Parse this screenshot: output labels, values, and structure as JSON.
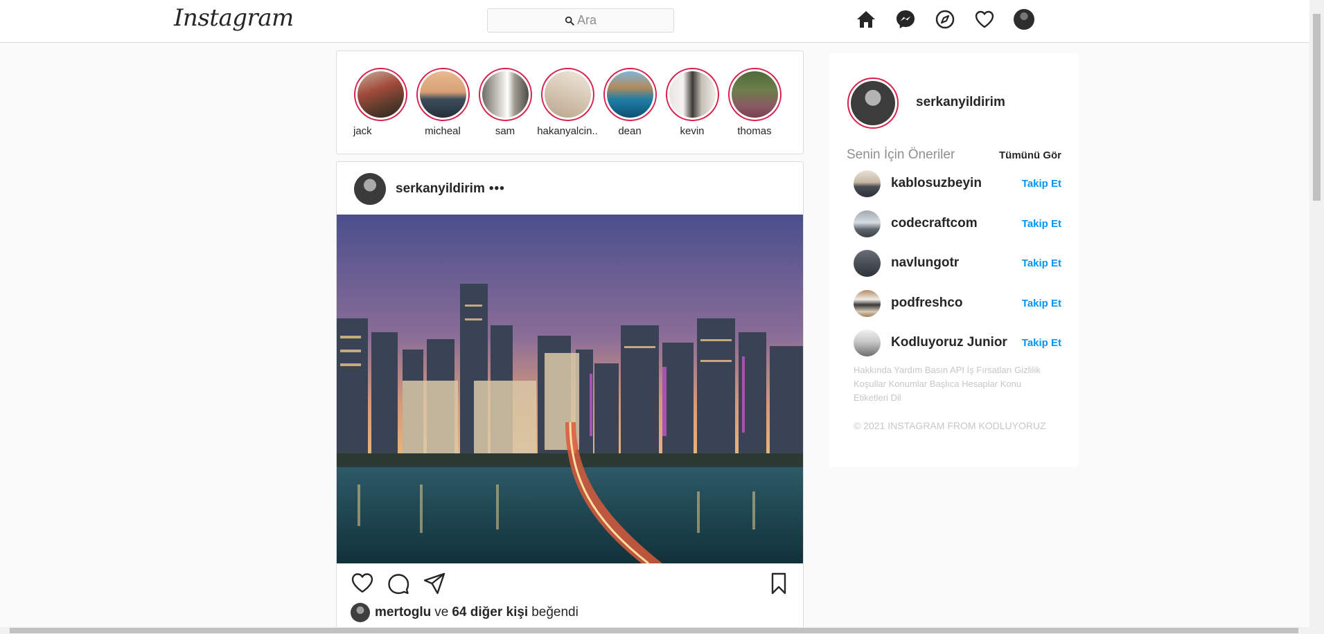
{
  "header": {
    "logo": "Instagram",
    "search_placeholder": "Ara",
    "icons": [
      "home-icon",
      "messenger-icon",
      "explore-icon",
      "heart-icon",
      "profile-avatar"
    ]
  },
  "stories": [
    {
      "name": "jack"
    },
    {
      "name": "micheal"
    },
    {
      "name": "sam"
    },
    {
      "name": "hakanyalcin.."
    },
    {
      "name": "dean"
    },
    {
      "name": "kevin"
    },
    {
      "name": "thomas"
    }
  ],
  "post": {
    "username": "serkanyildirim",
    "more": "•••",
    "liked_by": "mertoglu",
    "liked_connector": "ve",
    "liked_others": "64 diğer kişi",
    "liked_suffix": "beğendi"
  },
  "sidebar": {
    "username": "serkanyildirim",
    "suggestions_title": "Senin İçin Öneriler",
    "see_all": "Tümünü Gör",
    "follow_label": "Takip Et",
    "suggestions": [
      {
        "name": "kablosuzbeyin"
      },
      {
        "name": "codecraftcom"
      },
      {
        "name": "navlungotr"
      },
      {
        "name": "podfreshco"
      },
      {
        "name": "Kodluyoruz Junior"
      }
    ],
    "footer_links": "Hakkında Yardım Basın API İş Fırsatları Gizlilik Koşullar Konumlar Başlıca Hesaplar Konu Etiketleri Dil",
    "copyright": "© 2021 INSTAGRAM FROM KODLUYORUZ"
  },
  "colors": {
    "accent_blue": "#0095f6",
    "story_ring": "#d6214d",
    "border": "#dbdbdb"
  }
}
